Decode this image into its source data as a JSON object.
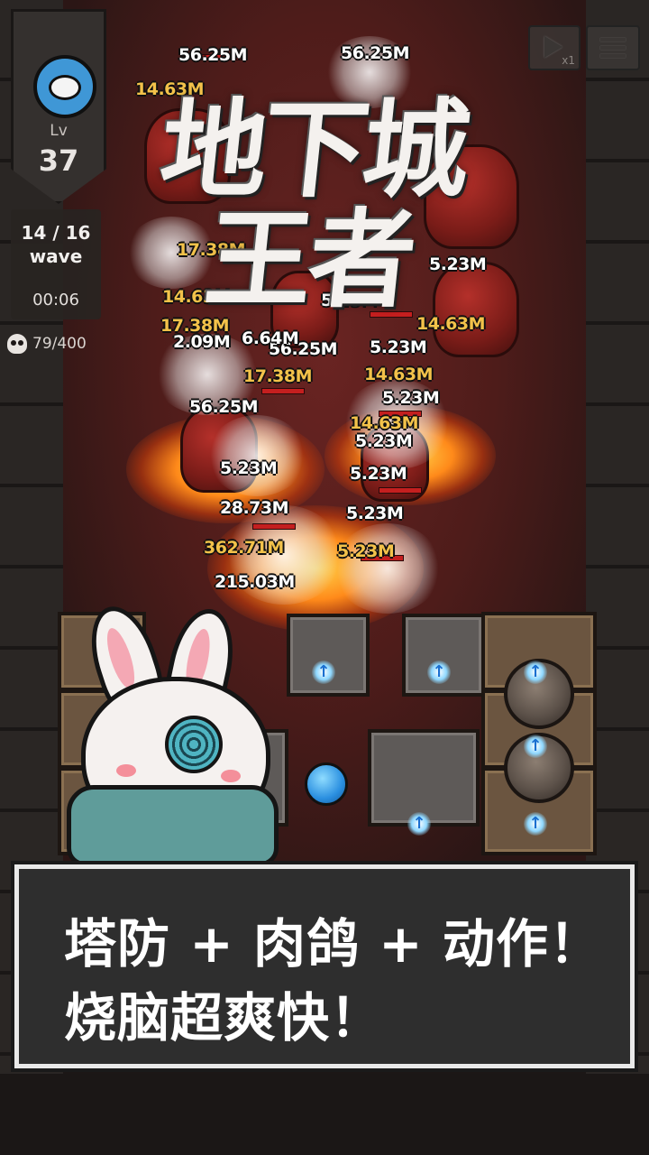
{
  "hud": {
    "level_label": "Lv",
    "level_value": "37",
    "wave_count": "14 / 16",
    "wave_label": "wave",
    "timer": "00:06",
    "kills": "79/400",
    "speed_label": "x1"
  },
  "logo": {
    "line1": "地下城",
    "line2": "王者"
  },
  "damage_numbers": [
    "56.25M",
    "56.25M",
    "14.63M",
    "5.23M",
    "14.63M",
    "17.38M",
    "17.38M",
    "5.23M",
    "14.63M",
    "5.23M",
    "17.38M",
    "56.25M",
    "14.63M",
    "5.23M",
    "56.25M",
    "14.63M",
    "5.23M",
    "5.23M",
    "5.23M",
    "28.73M",
    "5.23M",
    "362.71M",
    "5.23M",
    "215.03M",
    "2.09M",
    "6.64M"
  ],
  "caption": {
    "line1": "塔防 + 肉鸽 + 动作！",
    "line2": "烧脑超爽快！"
  },
  "icons": {
    "level_avatar": "blue-eye-avatar-icon",
    "kills": "skull-icon",
    "speed": "play-icon",
    "menu": "hamburger-menu-icon",
    "tower_upgrade": "up-arrow-icon"
  },
  "colors": {
    "floor": "#5a1e1c",
    "caption_bg": "#2e2e2e",
    "caption_border": "#e9e9e9",
    "damage_gold": "#f3c24a",
    "upgrade_blue": "#8fd8ff"
  }
}
